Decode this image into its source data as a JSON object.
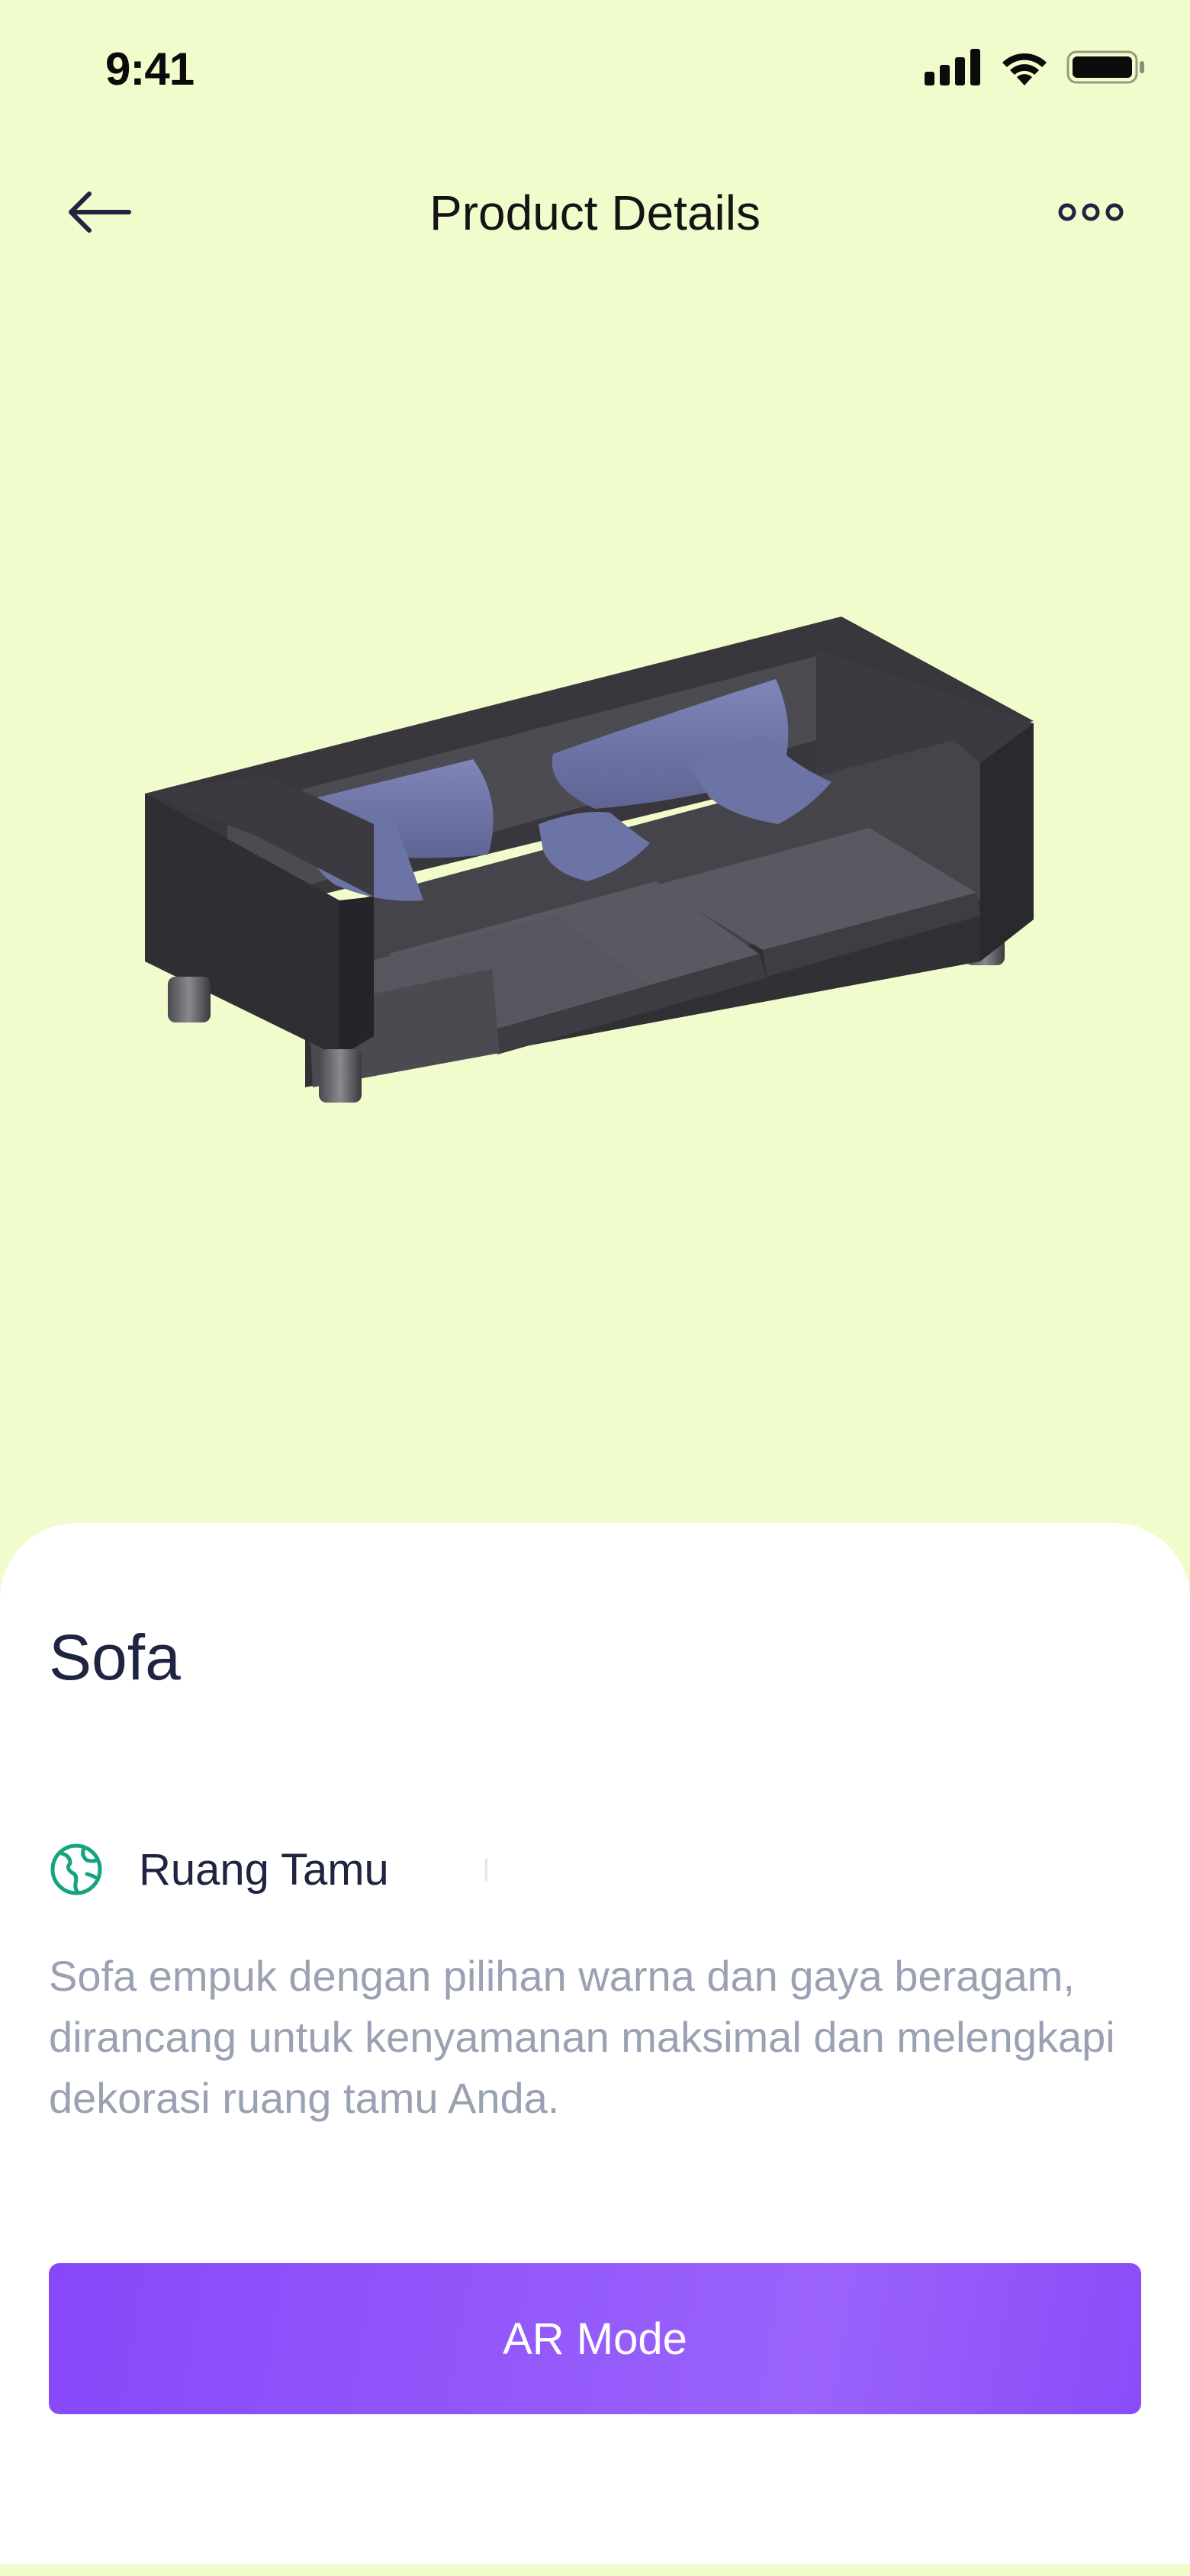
{
  "status_bar": {
    "time": "9:41",
    "icons": [
      "cellular-signal-icon",
      "wifi-icon",
      "battery-icon"
    ]
  },
  "nav": {
    "title": "Product Details",
    "back_icon": "arrow-left-icon",
    "more_icon": "more-horizontal-icon"
  },
  "product": {
    "image": "sofa-3d-model",
    "name": "Sofa",
    "category": {
      "icon": "globe-icon",
      "label": "Ruang Tamu"
    },
    "description": "Sofa empuk dengan pilihan warna dan gaya beragam, dirancang untuk kenyamanan maksimal dan melengkapi dekorasi ruang tamu Anda."
  },
  "actions": {
    "ar_mode_label": "AR Mode"
  },
  "colors": {
    "background": "#f0fccb",
    "sheet": "#ffffff",
    "accent": "#8748fa",
    "category_icon": "#16a37f",
    "title_text": "#1f2440",
    "description_text": "#9aa1b3"
  }
}
